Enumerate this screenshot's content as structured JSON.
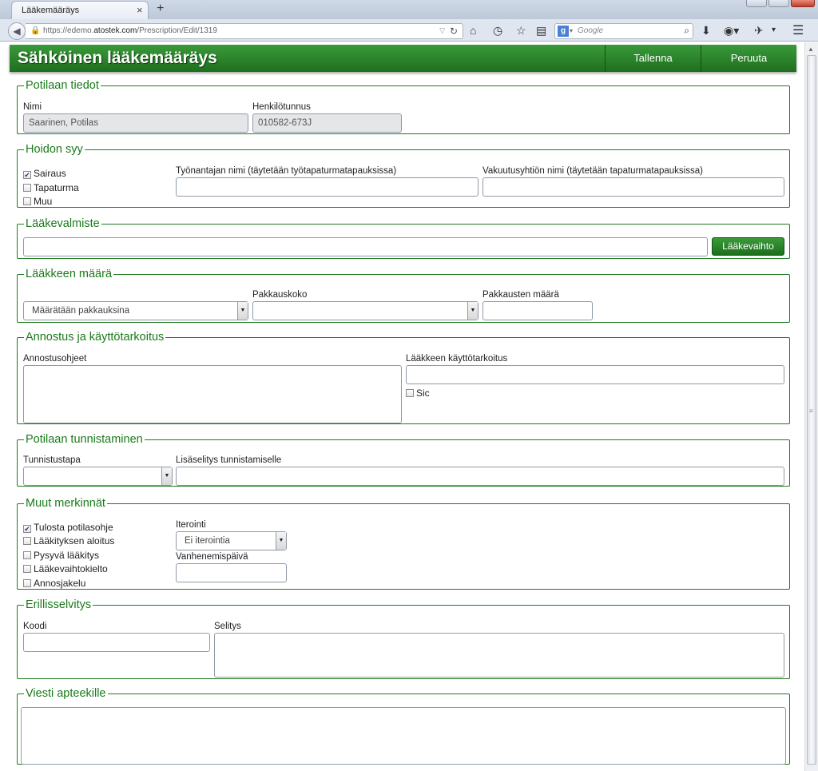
{
  "browser": {
    "tab_title": "Lääkemääräys",
    "tab_close": "×",
    "new_tab": "+",
    "url_host_prefix": "https://edemo.",
    "url_host_bold": "atostek.com",
    "url_path": "/Prescription/Edit/1319",
    "search_placeholder": "Google",
    "search_engine_icon": "google-icon"
  },
  "header": {
    "title": "Sähköinen lääkemääräys",
    "save_label": "Tallenna",
    "cancel_label": "Peruuta",
    "accent": "#1e6f1e"
  },
  "patient": {
    "legend": "Potilaan tiedot",
    "name_label": "Nimi",
    "name_value": "Saarinen, Potilas",
    "ssn_label": "Henkilötunnus",
    "ssn_value": "010582-673J"
  },
  "care_reason": {
    "legend": "Hoidon syy",
    "options": [
      {
        "label": "Sairaus",
        "checked": true
      },
      {
        "label": "Tapaturma",
        "checked": false
      },
      {
        "label": "Muu",
        "checked": false
      }
    ],
    "employer_label": "Työnantajan nimi (täytetään työtapaturmatapauksissa)",
    "employer_value": "",
    "insurer_label": "Vakuutusyhtiön nimi (täytetään tapaturmatapauksissa)",
    "insurer_value": ""
  },
  "product": {
    "legend": "Lääkevalmiste",
    "value": "",
    "swap_label": "Lääkevaihto"
  },
  "quantity": {
    "legend": "Lääkkeen määrä",
    "mode_value": "Määrätään pakkauksina",
    "pack_size_label": "Pakkauskoko",
    "pack_size_value": "",
    "pack_count_label": "Pakkausten määrä",
    "pack_count_value": ""
  },
  "dosage": {
    "legend": "Annostus ja käyttötarkoitus",
    "instructions_label": "Annostusohjeet",
    "purpose_label": "Lääkkeen käyttötarkoitus",
    "sic_label": "Sic",
    "sic_checked": false
  },
  "identification": {
    "legend": "Potilaan tunnistaminen",
    "method_label": "Tunnistustapa",
    "method_value": "",
    "details_label": "Lisäselitys tunnistamiselle",
    "details_value": ""
  },
  "other": {
    "legend": "Muut merkinnät",
    "options": [
      {
        "label": "Tulosta potilasohje",
        "checked": true
      },
      {
        "label": "Lääkityksen aloitus",
        "checked": false
      },
      {
        "label": "Pysyvä lääkitys",
        "checked": false
      },
      {
        "label": "Lääkevaihtokielto",
        "checked": false
      },
      {
        "label": "Annosjakelu",
        "checked": false
      }
    ],
    "iteration_label": "Iterointi",
    "iteration_value": "Ei iterointia",
    "expiry_label": "Vanhenemispäivä",
    "expiry_value": ""
  },
  "separate": {
    "legend": "Erillisselvitys",
    "code_label": "Koodi",
    "code_value": "",
    "explanation_label": "Selitys"
  },
  "pharmacy": {
    "legend": "Viesti apteekille"
  }
}
